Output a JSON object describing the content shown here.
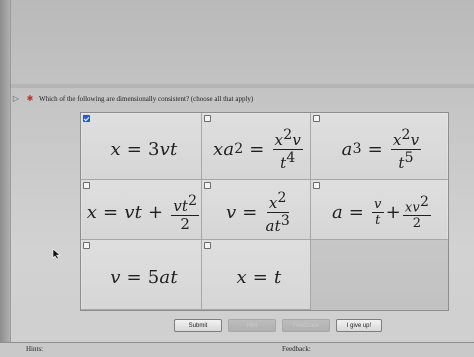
{
  "question": {
    "text": "Which of the following are dimensionally consistent? (choose all that apply)"
  },
  "options": [
    {
      "label": "x = 3vt",
      "checked": true
    },
    {
      "label": "xa^2 = x^2v / t^4",
      "checked": false
    },
    {
      "label": "a^3 = x^2v / t^5",
      "checked": false
    },
    {
      "label": "x = vt + vt^2 / 2",
      "checked": false
    },
    {
      "label": "v = x^2 / at^3",
      "checked": false
    },
    {
      "label": "a = v / t + xv^2 / 2",
      "checked": false
    },
    {
      "label": "v = 5at",
      "checked": false
    },
    {
      "label": "x = t",
      "checked": false
    }
  ],
  "actions": {
    "submit": "Submit",
    "hint": "Hint",
    "feedback": "Feedback",
    "give_up": "I give up!"
  },
  "footer": {
    "hints": "Hints:",
    "feedback": "Feedback:"
  },
  "colors": {
    "checked": "#2d63c8",
    "warning_icon": "#b4322f"
  }
}
